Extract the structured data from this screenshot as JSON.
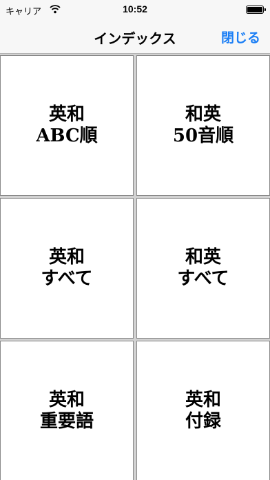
{
  "status_bar": {
    "carrier": "キャリア",
    "time": "10:52",
    "wifi_icon": "wifi-icon",
    "battery_icon": "battery-full-icon",
    "battery_level": 1.0
  },
  "nav": {
    "title": "インデックス",
    "close_label": "閉じる",
    "accent_color": "#1a7ef5"
  },
  "tiles": [
    {
      "line1": "英和",
      "line2": "ABC順"
    },
    {
      "line1": "和英",
      "line2": "50音順"
    },
    {
      "line1": "英和",
      "line2": "すべて"
    },
    {
      "line1": "和英",
      "line2": "すべて"
    },
    {
      "line1": "英和",
      "line2": "重要語"
    },
    {
      "line1": "英和",
      "line2": "付録"
    }
  ]
}
